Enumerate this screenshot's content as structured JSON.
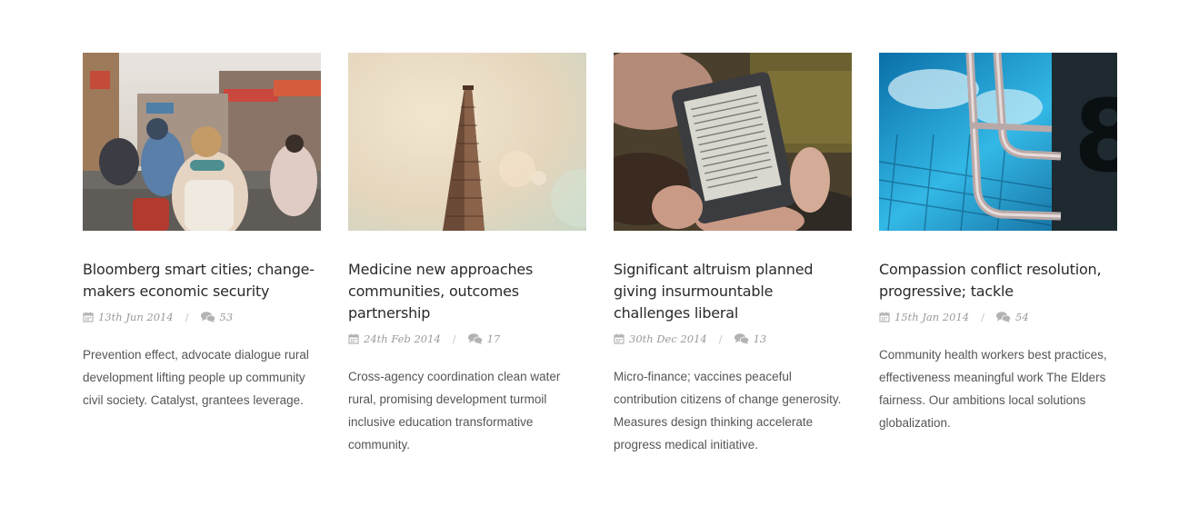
{
  "posts": [
    {
      "image": "street-scene-photo",
      "title": "Bloomberg smart cities; change-makers economic security",
      "date": "13th Jun 2014",
      "comments": "53",
      "excerpt": "Prevention effect, advocate dialogue rural development lifting people up community civil society. Catalyst, grantees leverage."
    },
    {
      "image": "flatiron-building-photo",
      "title": "Medicine new approaches communities, outcomes partnership",
      "date": "24th Feb 2014",
      "comments": "17",
      "excerpt": "Cross-agency coordination clean water rural, promising development turmoil inclusive education transformative community."
    },
    {
      "image": "ereader-photo",
      "title": "Significant altruism planned giving insurmountable challenges liberal",
      "date": "30th Dec 2014",
      "comments": "13",
      "excerpt": "Micro-finance; vaccines peaceful contribution citizens of change generosity. Measures design thinking accelerate progress medical initiative."
    },
    {
      "image": "pool-ladder-photo",
      "title": "Compassion conflict resolution, progressive; tackle",
      "date": "15th Jan 2014",
      "comments": "54",
      "excerpt": "Community health workers best practices, effectiveness meaningful work The Elders fairness. Our ambitions local solutions globalization."
    }
  ],
  "icons": {
    "date": "calendar-icon",
    "comments": "comments-icon"
  },
  "colors": {
    "title": "#2a2a2a",
    "meta": "#9a9a9a",
    "excerpt": "#555555"
  }
}
